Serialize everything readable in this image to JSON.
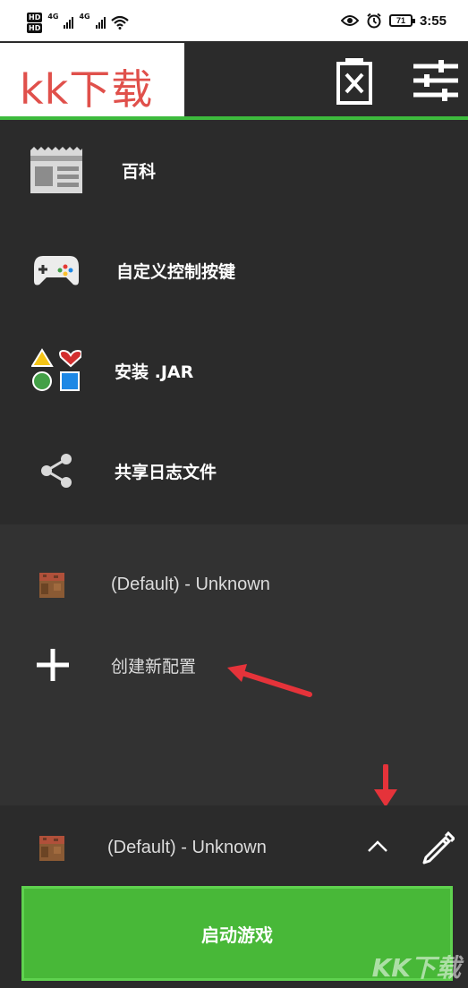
{
  "status_bar": {
    "hd_badges": [
      "HD",
      "HD"
    ],
    "network_labels": [
      "4G",
      "4G"
    ],
    "battery": "71",
    "time": "3:55"
  },
  "app_bar": {
    "logo_text": "kk下载",
    "icons": [
      "clear-log-icon",
      "settings-sliders-icon"
    ],
    "accent_color": "#3dbb3d"
  },
  "menu": {
    "items": [
      {
        "label": "百科",
        "icon": "wiki-page-icon"
      },
      {
        "label": "自定义控制按键",
        "icon": "gamepad-icon"
      },
      {
        "label": "安装 .JAR",
        "icon": "shapes-icon"
      },
      {
        "label": "共享日志文件",
        "icon": "share-icon"
      }
    ]
  },
  "profiles": {
    "default_profile": "(Default) - Unknown",
    "create_label": "创建新配置"
  },
  "bottom_bar": {
    "selected_profile": "(Default) - Unknown",
    "launch_label": "启动游戏",
    "launch_color": "#48b838"
  },
  "watermark": "KK下载"
}
